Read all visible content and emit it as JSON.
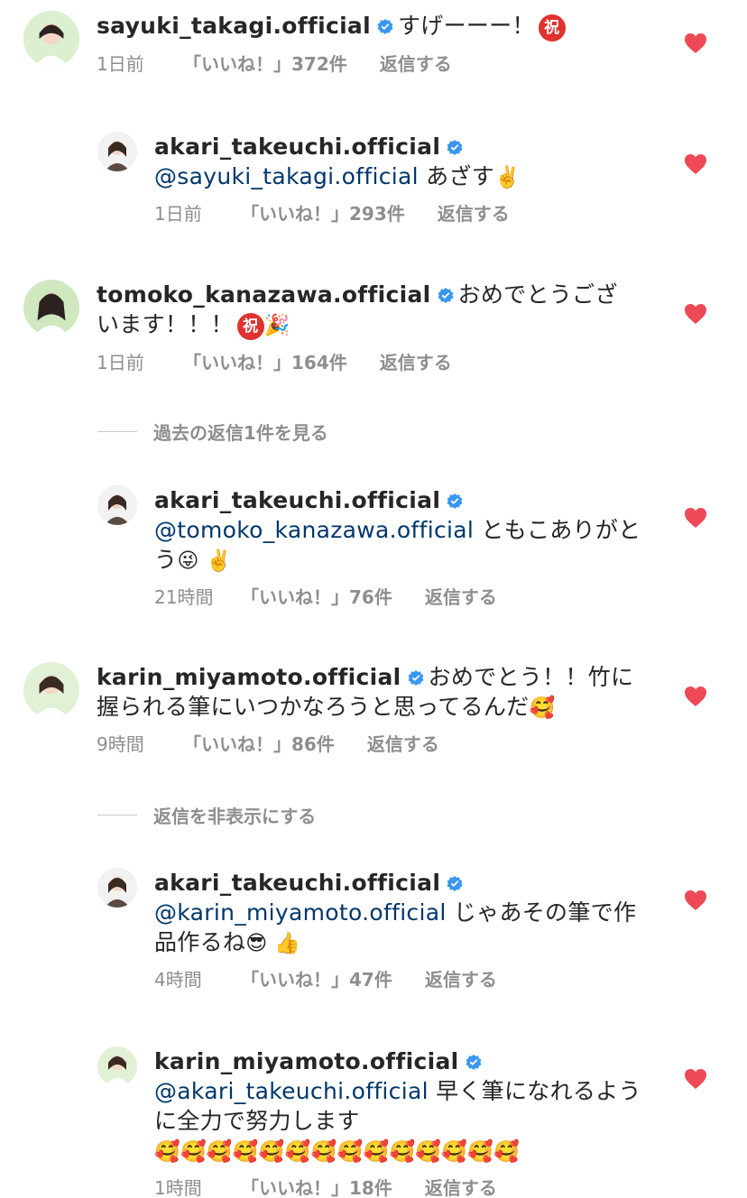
{
  "colors": {
    "heart": "#ed4956",
    "verified": "#3897f0",
    "mention": "#00376b",
    "meta": "#8e8e8e"
  },
  "comments": [
    {
      "username": "sayuki_takagi.official",
      "text": "すげーーー！",
      "suffix_badge": "祝",
      "time": "1日前",
      "likes": "「いいね！」372件",
      "reply": "返信する"
    },
    {
      "username": "akari_takeuchi.official",
      "mention": "@sayuki_takagi.official",
      "text": "あざす",
      "emoji": "✌️",
      "time": "1日前",
      "likes": "「いいね！」293件",
      "reply": "返信する"
    },
    {
      "username": "tomoko_kanazawa.official",
      "text": "おめでとうございます！！！",
      "suffix_badge": "祝",
      "emoji": "🎉",
      "time": "1日前",
      "likes": "「いいね！」164件",
      "reply": "返信する"
    },
    {
      "toggle": "過去の返信1件を見る"
    },
    {
      "username": "akari_takeuchi.official",
      "mention": "@tomoko_kanazawa.official",
      "text": "ともこありがとう",
      "emoji": "😜 ✌️",
      "time": "21時間",
      "likes": "「いいね！」76件",
      "reply": "返信する"
    },
    {
      "username": "karin_miyamoto.official",
      "text": "おめでとう！！竹に握られる筆にいつかなろうと思ってるんだ",
      "emoji": "🥰",
      "time": "9時間",
      "likes": "「いいね！」86件",
      "reply": "返信する"
    },
    {
      "toggle": "返信を非表示にする"
    },
    {
      "username": "akari_takeuchi.official",
      "mention": "@karin_miyamoto.official",
      "text": "じゃあその筆で作品作るね",
      "emoji": "😎 👍",
      "time": "4時間",
      "likes": "「いいね！」47件",
      "reply": "返信する"
    },
    {
      "username": "karin_miyamoto.official",
      "mention": "@akari_takeuchi.official",
      "text": "早く筆になれるように全力で努力します",
      "emoji": "🥰🥰🥰🥰🥰🥰🥰🥰🥰🥰🥰🥰🥰🥰",
      "time": "1時間",
      "likes": "「いいね！」18件",
      "reply": "返信する"
    }
  ]
}
